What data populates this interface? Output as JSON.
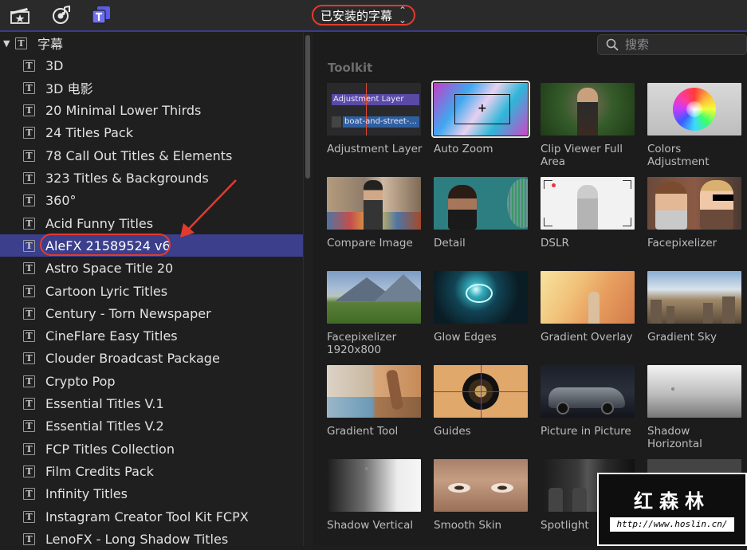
{
  "toolbar": {
    "icons": [
      "clapperboard-star-icon",
      "music-camera-icon",
      "titles-t-icon"
    ],
    "library_selector": "已安装的字幕",
    "selector_chevron": "⌃⌄"
  },
  "sidebar": {
    "root_label": "字幕",
    "items": [
      "3D",
      "3D 电影",
      "20 Minimal Lower Thirds",
      "24 Titles Pack",
      "78 Call Out Titles & Elements",
      "323 Titles & Backgrounds",
      "360°",
      "Acid Funny Titles",
      "AleFX 21589524 v6",
      "Astro Space Title 20",
      "Cartoon Lyric Titles",
      "Century - Torn Newspaper",
      "CineFlare Easy Titles",
      "Clouder Broadcast Package",
      "Crypto Pop",
      "Essential Titles V.1",
      "Essential Titles V.2",
      "FCP Titles Collection",
      "Film Credits Pack",
      "Infinity Titles",
      "Instagram Creator Tool Kit FCPX",
      "LenoFX - Long Shadow Titles"
    ],
    "selected_index": 8
  },
  "browser": {
    "search_placeholder": "搜索",
    "section_title": "Toolkit",
    "adjustment_thumb_text_1": "Adjustment Layer",
    "adjustment_thumb_text_2": "boat-and-street-...",
    "tiles": [
      [
        "Adjustment Layer"
      ],
      [
        "Auto Zoom"
      ],
      [
        "Clip Viewer Full",
        "Area"
      ],
      [
        "Colors",
        "Adjustment"
      ],
      [
        "Compare Image"
      ],
      [
        "Detail"
      ],
      [
        "DSLR"
      ],
      [
        "Facepixelizer"
      ],
      [
        "Facepixelizer",
        "1920x800"
      ],
      [
        "Glow Edges"
      ],
      [
        "Gradient Overlay"
      ],
      [
        "Gradient Sky"
      ],
      [
        "Gradient Tool"
      ],
      [
        "Guides"
      ],
      [
        "Picture in Picture"
      ],
      [
        "Shadow",
        "Horizontal"
      ],
      [
        "Shadow Vertical"
      ],
      [
        "Smooth Skin"
      ],
      [
        "Spotlight"
      ]
    ]
  },
  "watermark": {
    "brand": "红森林",
    "url": "http://www.hoslin.cn/"
  },
  "colors": {
    "selection": "#3b3f8c",
    "annotation_red": "#e23b2e"
  }
}
